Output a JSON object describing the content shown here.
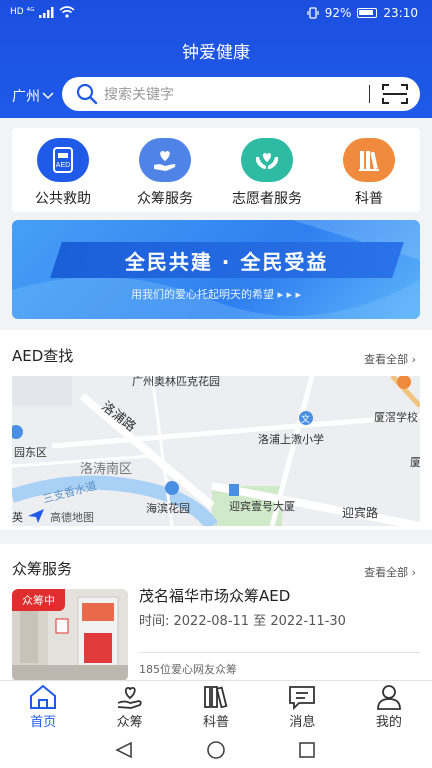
{
  "status_bar": {
    "network": "HD ⁴ᴳ",
    "battery": "92%",
    "time": "23:10"
  },
  "header": {
    "title": "钟爱健康",
    "city": "广州",
    "search_placeholder": "搜索关键字"
  },
  "quick_actions": [
    {
      "label": "公共救助",
      "icon": "aed-icon"
    },
    {
      "label": "众筹服务",
      "icon": "heart-hand-icon"
    },
    {
      "label": "志愿者服务",
      "icon": "hands-heart-icon"
    },
    {
      "label": "科普",
      "icon": "books-icon"
    }
  ],
  "banner": {
    "headline": "全民共建 · 全民受益",
    "subtitle": "用我们的爱心托起明天的希望 ▸ ▸ ▸"
  },
  "aed_section": {
    "title": "AED查找",
    "more": "查看全部",
    "map_labels": [
      "广州奥林匹克花园",
      "洛浦路",
      "园东区",
      "洛涛南区",
      "洛浦上漖小学",
      "厦滘学校",
      "海滨花园",
      "迎宾壹号大厦",
      "迎宾路",
      "三支香水道",
      "高德地图",
      "英",
      "厦",
      "文"
    ]
  },
  "fund_section": {
    "title": "众筹服务",
    "more": "查看全部",
    "item": {
      "badge": "众筹中",
      "title": "茂名福华市场众筹AED",
      "date": "时间: 2022-08-11 至 2022-11-30",
      "donors": "185位爱心网友众筹"
    }
  },
  "tabs": [
    {
      "label": "首页",
      "icon": "home-icon"
    },
    {
      "label": "众筹",
      "icon": "heart-hand-icon"
    },
    {
      "label": "科普",
      "icon": "books-icon"
    },
    {
      "label": "消息",
      "icon": "message-icon"
    },
    {
      "label": "我的",
      "icon": "user-icon"
    }
  ],
  "colors": {
    "primary": "#1f5ae8",
    "badge_red": "#e02d2d"
  }
}
